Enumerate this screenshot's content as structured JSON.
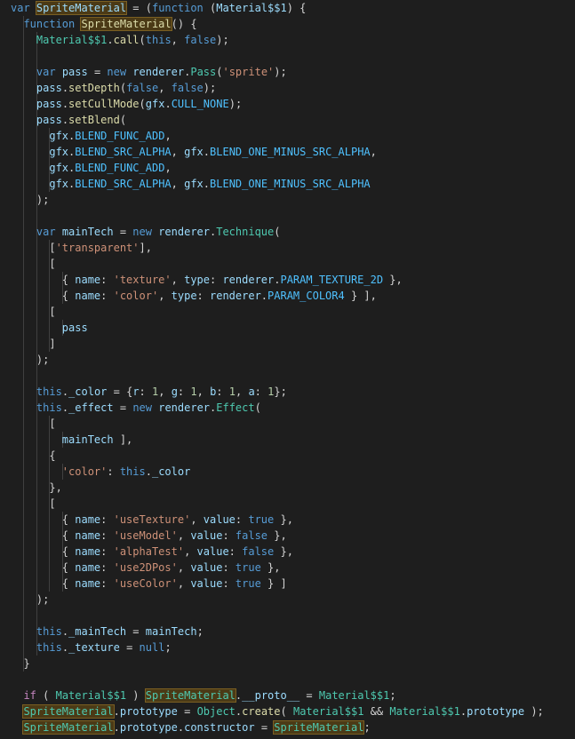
{
  "editor": {
    "language": "javascript",
    "theme": "dark",
    "colors": {
      "background": "#1e1e1e",
      "keyword": "#569cd6",
      "control": "#c586c0",
      "function": "#dcdcaa",
      "class": "#4ec9b0",
      "variable": "#9cdcfe",
      "constant": "#4fc1ff",
      "string": "#ce9178",
      "number": "#b5cea8",
      "punctuation": "#d4d4d4",
      "highlight": "#4b3a16"
    },
    "lines": [
      [
        [
          "kw",
          "var "
        ],
        [
          "var",
          "SpriteMaterial",
          "hl"
        ],
        [
          "punc",
          " = ("
        ],
        [
          "kw",
          "function"
        ],
        [
          "punc",
          " ("
        ],
        [
          "var",
          "Material$$1"
        ],
        [
          "punc",
          ") {"
        ]
      ],
      [
        [
          "punc",
          "  "
        ],
        [
          "kw",
          "function "
        ],
        [
          "fn",
          "SpriteMaterial",
          "hl"
        ],
        [
          "punc",
          "() {"
        ]
      ],
      [
        [
          "punc",
          "    "
        ],
        [
          "cls",
          "Material$$1"
        ],
        [
          "punc",
          "."
        ],
        [
          "fn",
          "call"
        ],
        [
          "punc",
          "("
        ],
        [
          "kw",
          "this"
        ],
        [
          "punc",
          ", "
        ],
        [
          "bool",
          "false"
        ],
        [
          "punc",
          ");"
        ]
      ],
      [],
      [
        [
          "punc",
          "    "
        ],
        [
          "kw",
          "var "
        ],
        [
          "var",
          "pass"
        ],
        [
          "punc",
          " = "
        ],
        [
          "kw",
          "new "
        ],
        [
          "var",
          "renderer"
        ],
        [
          "punc",
          "."
        ],
        [
          "cls",
          "Pass"
        ],
        [
          "punc",
          "("
        ],
        [
          "str",
          "'sprite'"
        ],
        [
          "punc",
          ");"
        ]
      ],
      [
        [
          "punc",
          "    "
        ],
        [
          "var",
          "pass"
        ],
        [
          "punc",
          "."
        ],
        [
          "fn",
          "setDepth"
        ],
        [
          "punc",
          "("
        ],
        [
          "bool",
          "false"
        ],
        [
          "punc",
          ", "
        ],
        [
          "bool",
          "false"
        ],
        [
          "punc",
          ");"
        ]
      ],
      [
        [
          "punc",
          "    "
        ],
        [
          "var",
          "pass"
        ],
        [
          "punc",
          "."
        ],
        [
          "fn",
          "setCullMode"
        ],
        [
          "punc",
          "("
        ],
        [
          "var",
          "gfx"
        ],
        [
          "punc",
          "."
        ],
        [
          "const",
          "CULL_NONE"
        ],
        [
          "punc",
          ");"
        ]
      ],
      [
        [
          "punc",
          "    "
        ],
        [
          "var",
          "pass"
        ],
        [
          "punc",
          "."
        ],
        [
          "fn",
          "setBlend"
        ],
        [
          "punc",
          "("
        ]
      ],
      [
        [
          "punc",
          "      "
        ],
        [
          "var",
          "gfx"
        ],
        [
          "punc",
          "."
        ],
        [
          "const",
          "BLEND_FUNC_ADD"
        ],
        [
          "punc",
          ","
        ]
      ],
      [
        [
          "punc",
          "      "
        ],
        [
          "var",
          "gfx"
        ],
        [
          "punc",
          "."
        ],
        [
          "const",
          "BLEND_SRC_ALPHA"
        ],
        [
          "punc",
          ", "
        ],
        [
          "var",
          "gfx"
        ],
        [
          "punc",
          "."
        ],
        [
          "const",
          "BLEND_ONE_MINUS_SRC_ALPHA"
        ],
        [
          "punc",
          ","
        ]
      ],
      [
        [
          "punc",
          "      "
        ],
        [
          "var",
          "gfx"
        ],
        [
          "punc",
          "."
        ],
        [
          "const",
          "BLEND_FUNC_ADD"
        ],
        [
          "punc",
          ","
        ]
      ],
      [
        [
          "punc",
          "      "
        ],
        [
          "var",
          "gfx"
        ],
        [
          "punc",
          "."
        ],
        [
          "const",
          "BLEND_SRC_ALPHA"
        ],
        [
          "punc",
          ", "
        ],
        [
          "var",
          "gfx"
        ],
        [
          "punc",
          "."
        ],
        [
          "const",
          "BLEND_ONE_MINUS_SRC_ALPHA"
        ]
      ],
      [
        [
          "punc",
          "    );"
        ]
      ],
      [],
      [
        [
          "punc",
          "    "
        ],
        [
          "kw",
          "var "
        ],
        [
          "var",
          "mainTech"
        ],
        [
          "punc",
          " = "
        ],
        [
          "kw",
          "new "
        ],
        [
          "var",
          "renderer"
        ],
        [
          "punc",
          "."
        ],
        [
          "cls",
          "Technique"
        ],
        [
          "punc",
          "("
        ]
      ],
      [
        [
          "punc",
          "      ["
        ],
        [
          "str",
          "'transparent'"
        ],
        [
          "punc",
          "],"
        ]
      ],
      [
        [
          "punc",
          "      ["
        ]
      ],
      [
        [
          "punc",
          "        { "
        ],
        [
          "prop",
          "name"
        ],
        [
          "punc",
          ": "
        ],
        [
          "str",
          "'texture'"
        ],
        [
          "punc",
          ", "
        ],
        [
          "prop",
          "type"
        ],
        [
          "punc",
          ": "
        ],
        [
          "var",
          "renderer"
        ],
        [
          "punc",
          "."
        ],
        [
          "const",
          "PARAM_TEXTURE_2D"
        ],
        [
          "punc",
          " },"
        ]
      ],
      [
        [
          "punc",
          "        { "
        ],
        [
          "prop",
          "name"
        ],
        [
          "punc",
          ": "
        ],
        [
          "str",
          "'color'"
        ],
        [
          "punc",
          ", "
        ],
        [
          "prop",
          "type"
        ],
        [
          "punc",
          ": "
        ],
        [
          "var",
          "renderer"
        ],
        [
          "punc",
          "."
        ],
        [
          "const",
          "PARAM_COLOR4"
        ],
        [
          "punc",
          " } ],"
        ]
      ],
      [
        [
          "punc",
          "      ["
        ]
      ],
      [
        [
          "punc",
          "        "
        ],
        [
          "var",
          "pass"
        ]
      ],
      [
        [
          "punc",
          "      ]"
        ]
      ],
      [
        [
          "punc",
          "    );"
        ]
      ],
      [],
      [
        [
          "punc",
          "    "
        ],
        [
          "kw",
          "this"
        ],
        [
          "punc",
          "."
        ],
        [
          "prop",
          "_color"
        ],
        [
          "punc",
          " = {"
        ],
        [
          "prop",
          "r"
        ],
        [
          "punc",
          ": "
        ],
        [
          "num",
          "1"
        ],
        [
          "punc",
          ", "
        ],
        [
          "prop",
          "g"
        ],
        [
          "punc",
          ": "
        ],
        [
          "num",
          "1"
        ],
        [
          "punc",
          ", "
        ],
        [
          "prop",
          "b"
        ],
        [
          "punc",
          ": "
        ],
        [
          "num",
          "1"
        ],
        [
          "punc",
          ", "
        ],
        [
          "prop",
          "a"
        ],
        [
          "punc",
          ": "
        ],
        [
          "num",
          "1"
        ],
        [
          "punc",
          "};"
        ]
      ],
      [
        [
          "punc",
          "    "
        ],
        [
          "kw",
          "this"
        ],
        [
          "punc",
          "."
        ],
        [
          "prop",
          "_effect"
        ],
        [
          "punc",
          " = "
        ],
        [
          "kw",
          "new "
        ],
        [
          "var",
          "renderer"
        ],
        [
          "punc",
          "."
        ],
        [
          "cls",
          "Effect"
        ],
        [
          "punc",
          "("
        ]
      ],
      [
        [
          "punc",
          "      ["
        ]
      ],
      [
        [
          "punc",
          "        "
        ],
        [
          "var",
          "mainTech"
        ],
        [
          "punc",
          " ],"
        ]
      ],
      [
        [
          "punc",
          "      {"
        ]
      ],
      [
        [
          "punc",
          "        "
        ],
        [
          "str",
          "'color'"
        ],
        [
          "punc",
          ": "
        ],
        [
          "kw",
          "this"
        ],
        [
          "punc",
          "."
        ],
        [
          "prop",
          "_color"
        ]
      ],
      [
        [
          "punc",
          "      },"
        ]
      ],
      [
        [
          "punc",
          "      ["
        ]
      ],
      [
        [
          "punc",
          "        { "
        ],
        [
          "prop",
          "name"
        ],
        [
          "punc",
          ": "
        ],
        [
          "str",
          "'useTexture'"
        ],
        [
          "punc",
          ", "
        ],
        [
          "prop",
          "value"
        ],
        [
          "punc",
          ": "
        ],
        [
          "bool",
          "true"
        ],
        [
          "punc",
          " },"
        ]
      ],
      [
        [
          "punc",
          "        { "
        ],
        [
          "prop",
          "name"
        ],
        [
          "punc",
          ": "
        ],
        [
          "str",
          "'useModel'"
        ],
        [
          "punc",
          ", "
        ],
        [
          "prop",
          "value"
        ],
        [
          "punc",
          ": "
        ],
        [
          "bool",
          "false"
        ],
        [
          "punc",
          " },"
        ]
      ],
      [
        [
          "punc",
          "        { "
        ],
        [
          "prop",
          "name"
        ],
        [
          "punc",
          ": "
        ],
        [
          "str",
          "'alphaTest'"
        ],
        [
          "punc",
          ", "
        ],
        [
          "prop",
          "value"
        ],
        [
          "punc",
          ": "
        ],
        [
          "bool",
          "false"
        ],
        [
          "punc",
          " },"
        ]
      ],
      [
        [
          "punc",
          "        { "
        ],
        [
          "prop",
          "name"
        ],
        [
          "punc",
          ": "
        ],
        [
          "str",
          "'use2DPos'"
        ],
        [
          "punc",
          ", "
        ],
        [
          "prop",
          "value"
        ],
        [
          "punc",
          ": "
        ],
        [
          "bool",
          "true"
        ],
        [
          "punc",
          " },"
        ]
      ],
      [
        [
          "punc",
          "        { "
        ],
        [
          "prop",
          "name"
        ],
        [
          "punc",
          ": "
        ],
        [
          "str",
          "'useColor'"
        ],
        [
          "punc",
          ", "
        ],
        [
          "prop",
          "value"
        ],
        [
          "punc",
          ": "
        ],
        [
          "bool",
          "true"
        ],
        [
          "punc",
          " } ]"
        ]
      ],
      [
        [
          "punc",
          "    );"
        ]
      ],
      [],
      [
        [
          "punc",
          "    "
        ],
        [
          "kw",
          "this"
        ],
        [
          "punc",
          "."
        ],
        [
          "prop",
          "_mainTech"
        ],
        [
          "punc",
          " = "
        ],
        [
          "var",
          "mainTech"
        ],
        [
          "punc",
          ";"
        ]
      ],
      [
        [
          "punc",
          "    "
        ],
        [
          "kw",
          "this"
        ],
        [
          "punc",
          "."
        ],
        [
          "prop",
          "_texture"
        ],
        [
          "punc",
          " = "
        ],
        [
          "kw",
          "null"
        ],
        [
          "punc",
          ";"
        ]
      ],
      [
        [
          "punc",
          "  }"
        ]
      ],
      [],
      [
        [
          "punc",
          "  "
        ],
        [
          "ctrl",
          "if"
        ],
        [
          "punc",
          " ( "
        ],
        [
          "cls",
          "Material$$1"
        ],
        [
          "punc",
          " ) "
        ],
        [
          "cls",
          "SpriteMaterial",
          "hl"
        ],
        [
          "punc",
          "."
        ],
        [
          "prop",
          "__proto__"
        ],
        [
          "punc",
          " = "
        ],
        [
          "cls",
          "Material$$1"
        ],
        [
          "punc",
          ";"
        ]
      ],
      [
        [
          "punc",
          "  "
        ],
        [
          "cls",
          "SpriteMaterial",
          "hl"
        ],
        [
          "punc",
          "."
        ],
        [
          "prop",
          "prototype"
        ],
        [
          "punc",
          " = "
        ],
        [
          "cls",
          "Object"
        ],
        [
          "punc",
          "."
        ],
        [
          "fn",
          "create"
        ],
        [
          "punc",
          "( "
        ],
        [
          "cls",
          "Material$$1"
        ],
        [
          "punc",
          " && "
        ],
        [
          "cls",
          "Material$$1"
        ],
        [
          "punc",
          "."
        ],
        [
          "prop",
          "prototype"
        ],
        [
          "punc",
          " );"
        ]
      ],
      [
        [
          "punc",
          "  "
        ],
        [
          "cls",
          "SpriteMaterial",
          "hl"
        ],
        [
          "punc",
          "."
        ],
        [
          "prop",
          "prototype"
        ],
        [
          "punc",
          "."
        ],
        [
          "prop",
          "constructor"
        ],
        [
          "punc",
          " = "
        ],
        [
          "cls",
          "SpriteMaterial",
          "hl"
        ],
        [
          "punc",
          ";"
        ]
      ]
    ]
  }
}
